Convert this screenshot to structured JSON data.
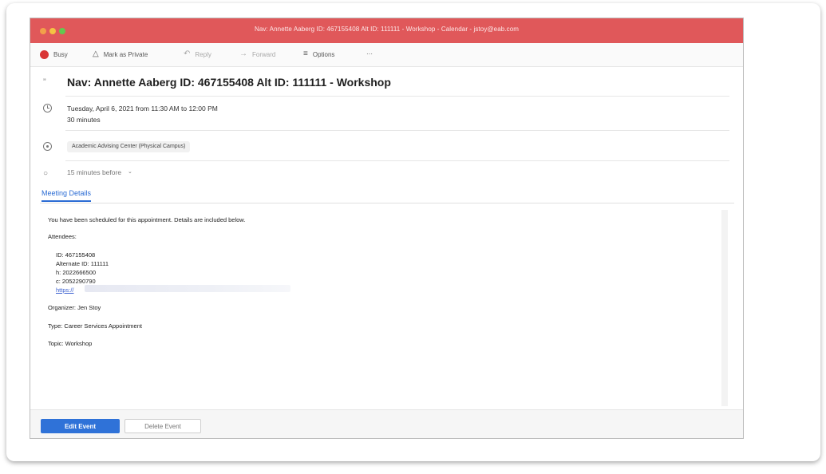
{
  "window": {
    "title": "Nav: Annette Aaberg ID: 467155408 Alt ID: 111111 - Workshop - Calendar - jstoy@eab.com"
  },
  "toolbar": {
    "busy": "Busy",
    "mark_private": "Mark as Private",
    "reply": "Reply",
    "forward": "Forward",
    "options": "Options",
    "more": "···"
  },
  "event": {
    "subject": "Nav: Annette Aaberg ID: 467155408 Alt ID: 111111 - Workshop",
    "time": "Tuesday, April 6, 2021 from 11:30 AM to 12:00 PM",
    "duration": "30 minutes",
    "location": "Academic Advising Center (Physical Campus)",
    "reminder": "15 minutes before"
  },
  "tabs": {
    "details": "Meeting Details"
  },
  "details": {
    "intro": "You have been scheduled for this appointment. Details are included below.",
    "attendees_label": "Attendees:",
    "attendee_id": "ID: 467155408",
    "attendee_alt_id": "Alternate ID: 111111",
    "attendee_h": "h: 2022666500",
    "attendee_c": "c: 2052290790",
    "attendee_link": "https://",
    "organizer": "Organizer: Jen Stoy",
    "type": "Type: Career Services Appointment",
    "topic": "Topic: Workshop"
  },
  "footer": {
    "edit": "Edit Event",
    "delete": "Delete Event"
  },
  "colors": {
    "titlebar": "#e0585a",
    "accent": "#2f72d8",
    "busy": "#d93636"
  }
}
